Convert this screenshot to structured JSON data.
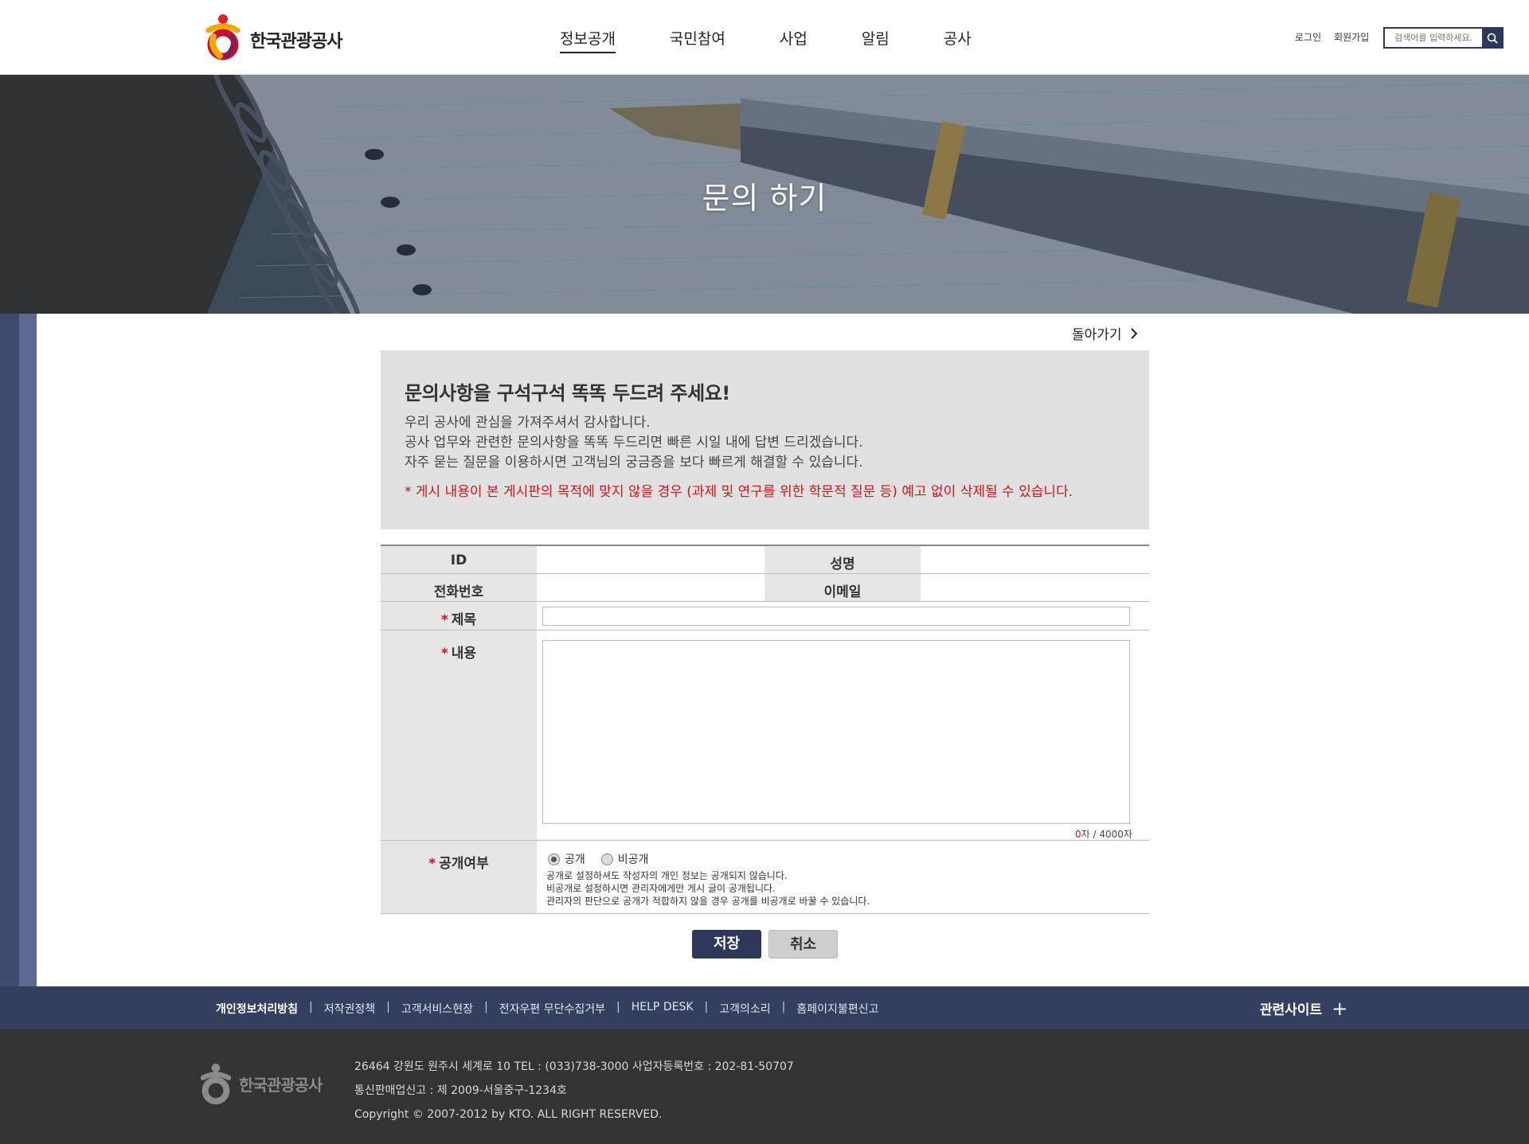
{
  "header": {
    "logo_text": "한국관광공사",
    "nav": [
      "정보공개",
      "국민참여",
      "사업",
      "알림",
      "공사"
    ],
    "login": "로그인",
    "signup": "회원가입",
    "search_placeholder": "검색어를 입력하세요."
  },
  "hero": {
    "title": "문의 하기"
  },
  "back_label": "돌아가기",
  "intro": {
    "heading": "문의사항을 구석구석 똑똑 두드려 주세요!",
    "line1": "우리 공사에 관심을 가져주셔서 감사합니다.",
    "line2": "공사 업무와 관련한 문의사항을 똑똑 두드리면 빠른 시일 내에 답변 드리겠습니다.",
    "line3": "자주 묻는 질문을 이용하시면 고객님의 궁금증을 보다 빠르게 해결할 수 있습니다.",
    "warning": "* 게시 내용이 본 게시판의 목적에 맞지 않을 경우 (과제 및 연구를 위한 학문적 질문 등) 예고 없이 삭제될 수 있습니다."
  },
  "form": {
    "id_label": "ID",
    "name_label": "성명",
    "phone_label": "전화번호",
    "email_label": "이메일",
    "required_mark": "*",
    "subject_label": "제목",
    "content_label": "내용",
    "public_label": "공개여부",
    "subject_value": "",
    "content_value": "",
    "counter_current": "0",
    "counter_rest": "자 / 4000자",
    "radio_public": "공개",
    "radio_private": "비공개",
    "selected": "공개",
    "note1": "공개로 설정하셔도 작성자의 개인 정보는 공개되지 않습니다.",
    "note2": "비공개로 설정하시면 관리자에게만 게시 글이 공개됩니다.",
    "note3": "관리자의 판단으로 공개가 적합하지 않을 경우 공개를 비공개로 바꿀 수 있습니다."
  },
  "buttons": {
    "save": "저장",
    "cancel": "취소"
  },
  "footer": {
    "links": [
      "개인정보처리방침",
      "저작권정책",
      "고객서비스현장",
      "전자우편 무단수집거부",
      "HELP DESK",
      "고객의소리",
      "홈페이지불편신고"
    ],
    "separator": "|",
    "related": "관련사이트",
    "related_icon": "+",
    "logo_text": "한국관광공사",
    "address": "26464 강원도 원주시 세계로 10 TEL : (033)738-3000 사업자등록번호 : 202-81-50707",
    "mail_order": "통신판매업신고 : 제 2009-서울중구-1234호",
    "copyright": "Copyright © 2007-2012 by KTO. ALL RIGHT RESERVED."
  },
  "colors": {
    "navy": "#2c3759",
    "footer_nav": "#353f5f",
    "footer_bg": "#333333",
    "warning": "#d0121b",
    "intro_bg": "#e1e1e1"
  }
}
